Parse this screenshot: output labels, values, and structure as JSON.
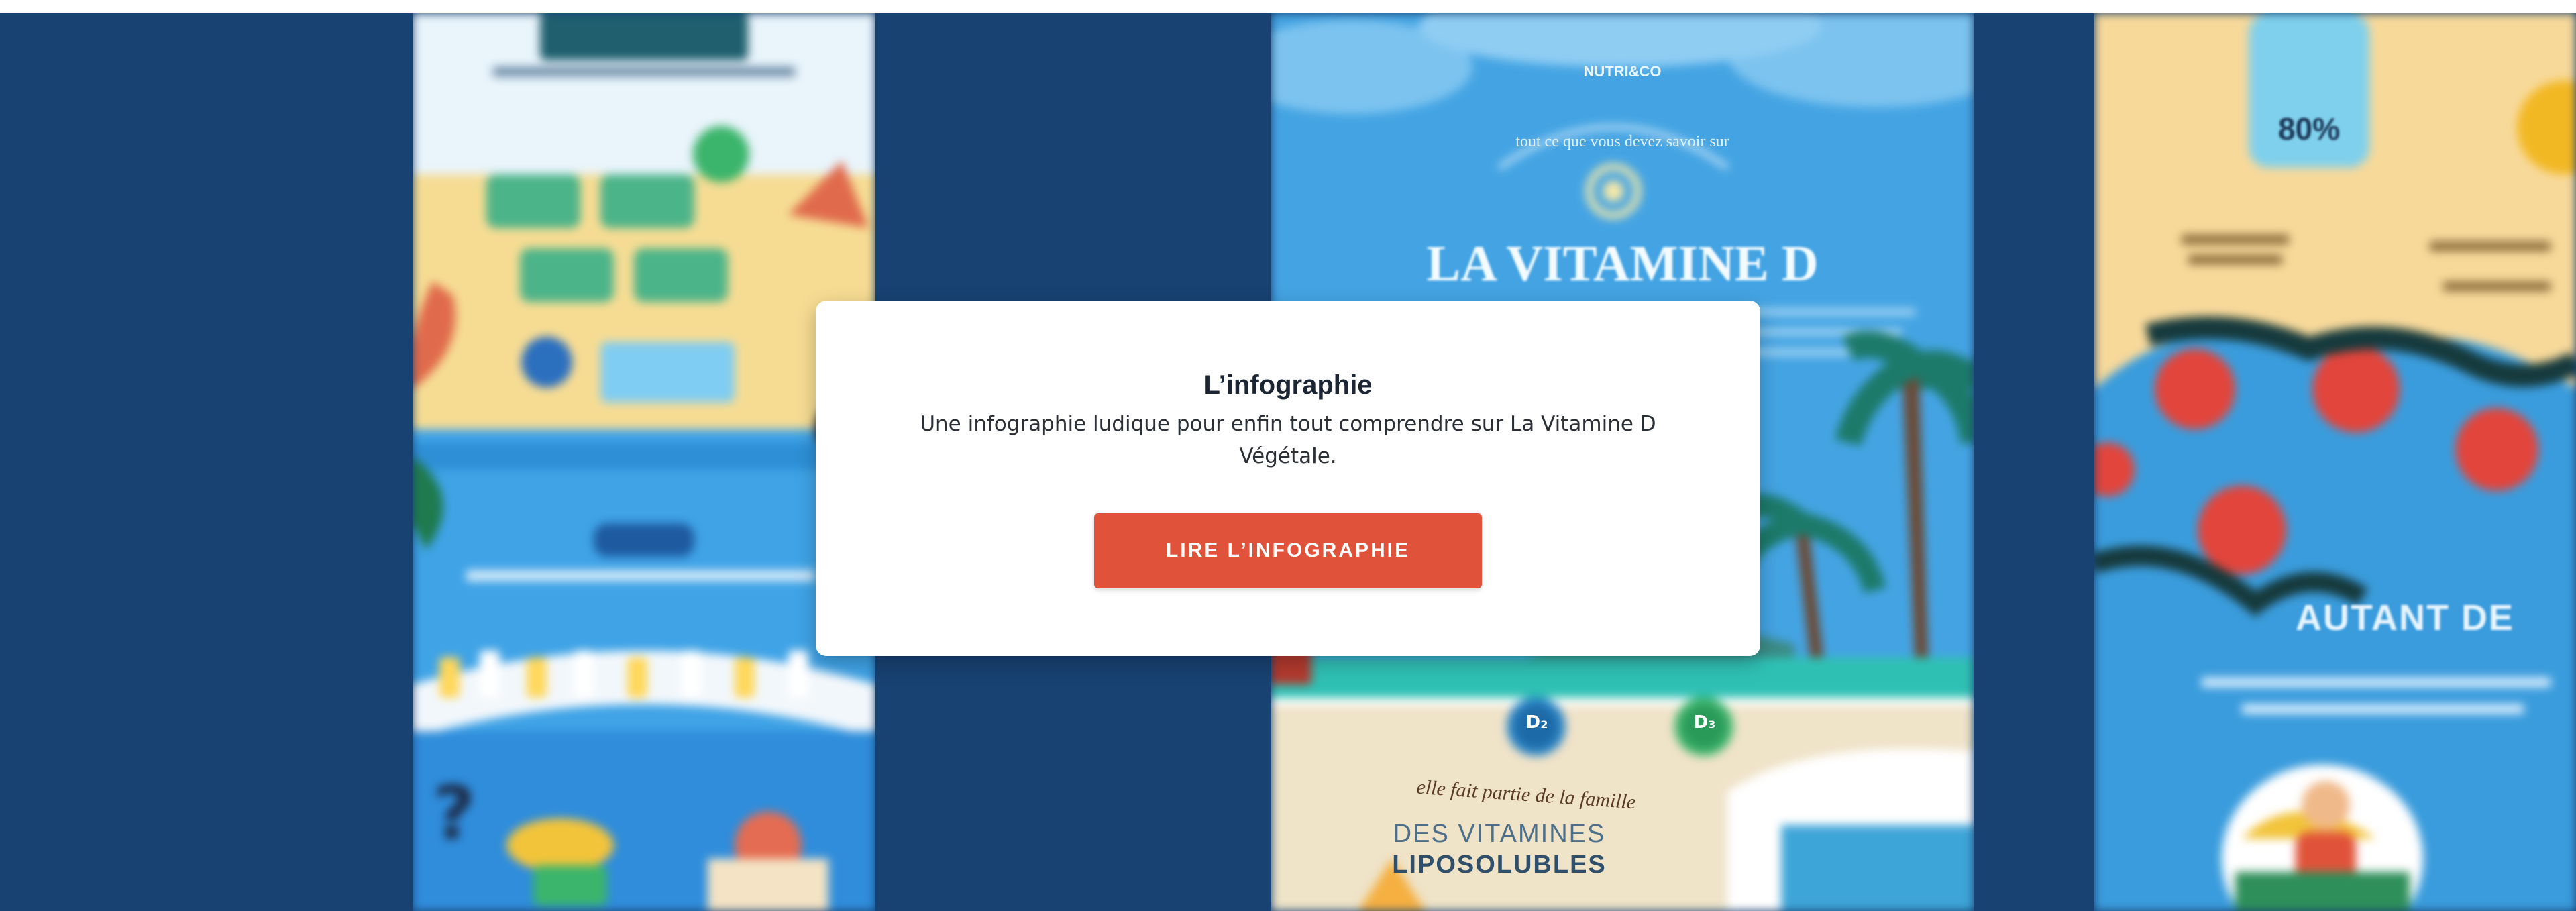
{
  "card": {
    "title": "L’infographie",
    "description": "Une infographie ludique pour enfin tout comprendre sur La Vitamine D Végétale.",
    "button_label": "LIRE L’INFOGRAPHIE"
  },
  "infographic_center": {
    "brand": "NUTRI&CO",
    "headline": "LA VITAMINE D",
    "arc_text": "tout ce que vous devez savoir sur",
    "badge_d2": "D₂",
    "badge_d3": "D₃",
    "family_text": "elle fait partie de la famille",
    "family_line1": "DES VITAMINES",
    "family_line2": "LIPOSOLUBLES"
  },
  "infographic_right": {
    "percent": "80%",
    "banner": "AUTANT DE"
  },
  "colors": {
    "page_background": "#184272",
    "accent": "#e0533a",
    "card_background": "#ffffff"
  }
}
